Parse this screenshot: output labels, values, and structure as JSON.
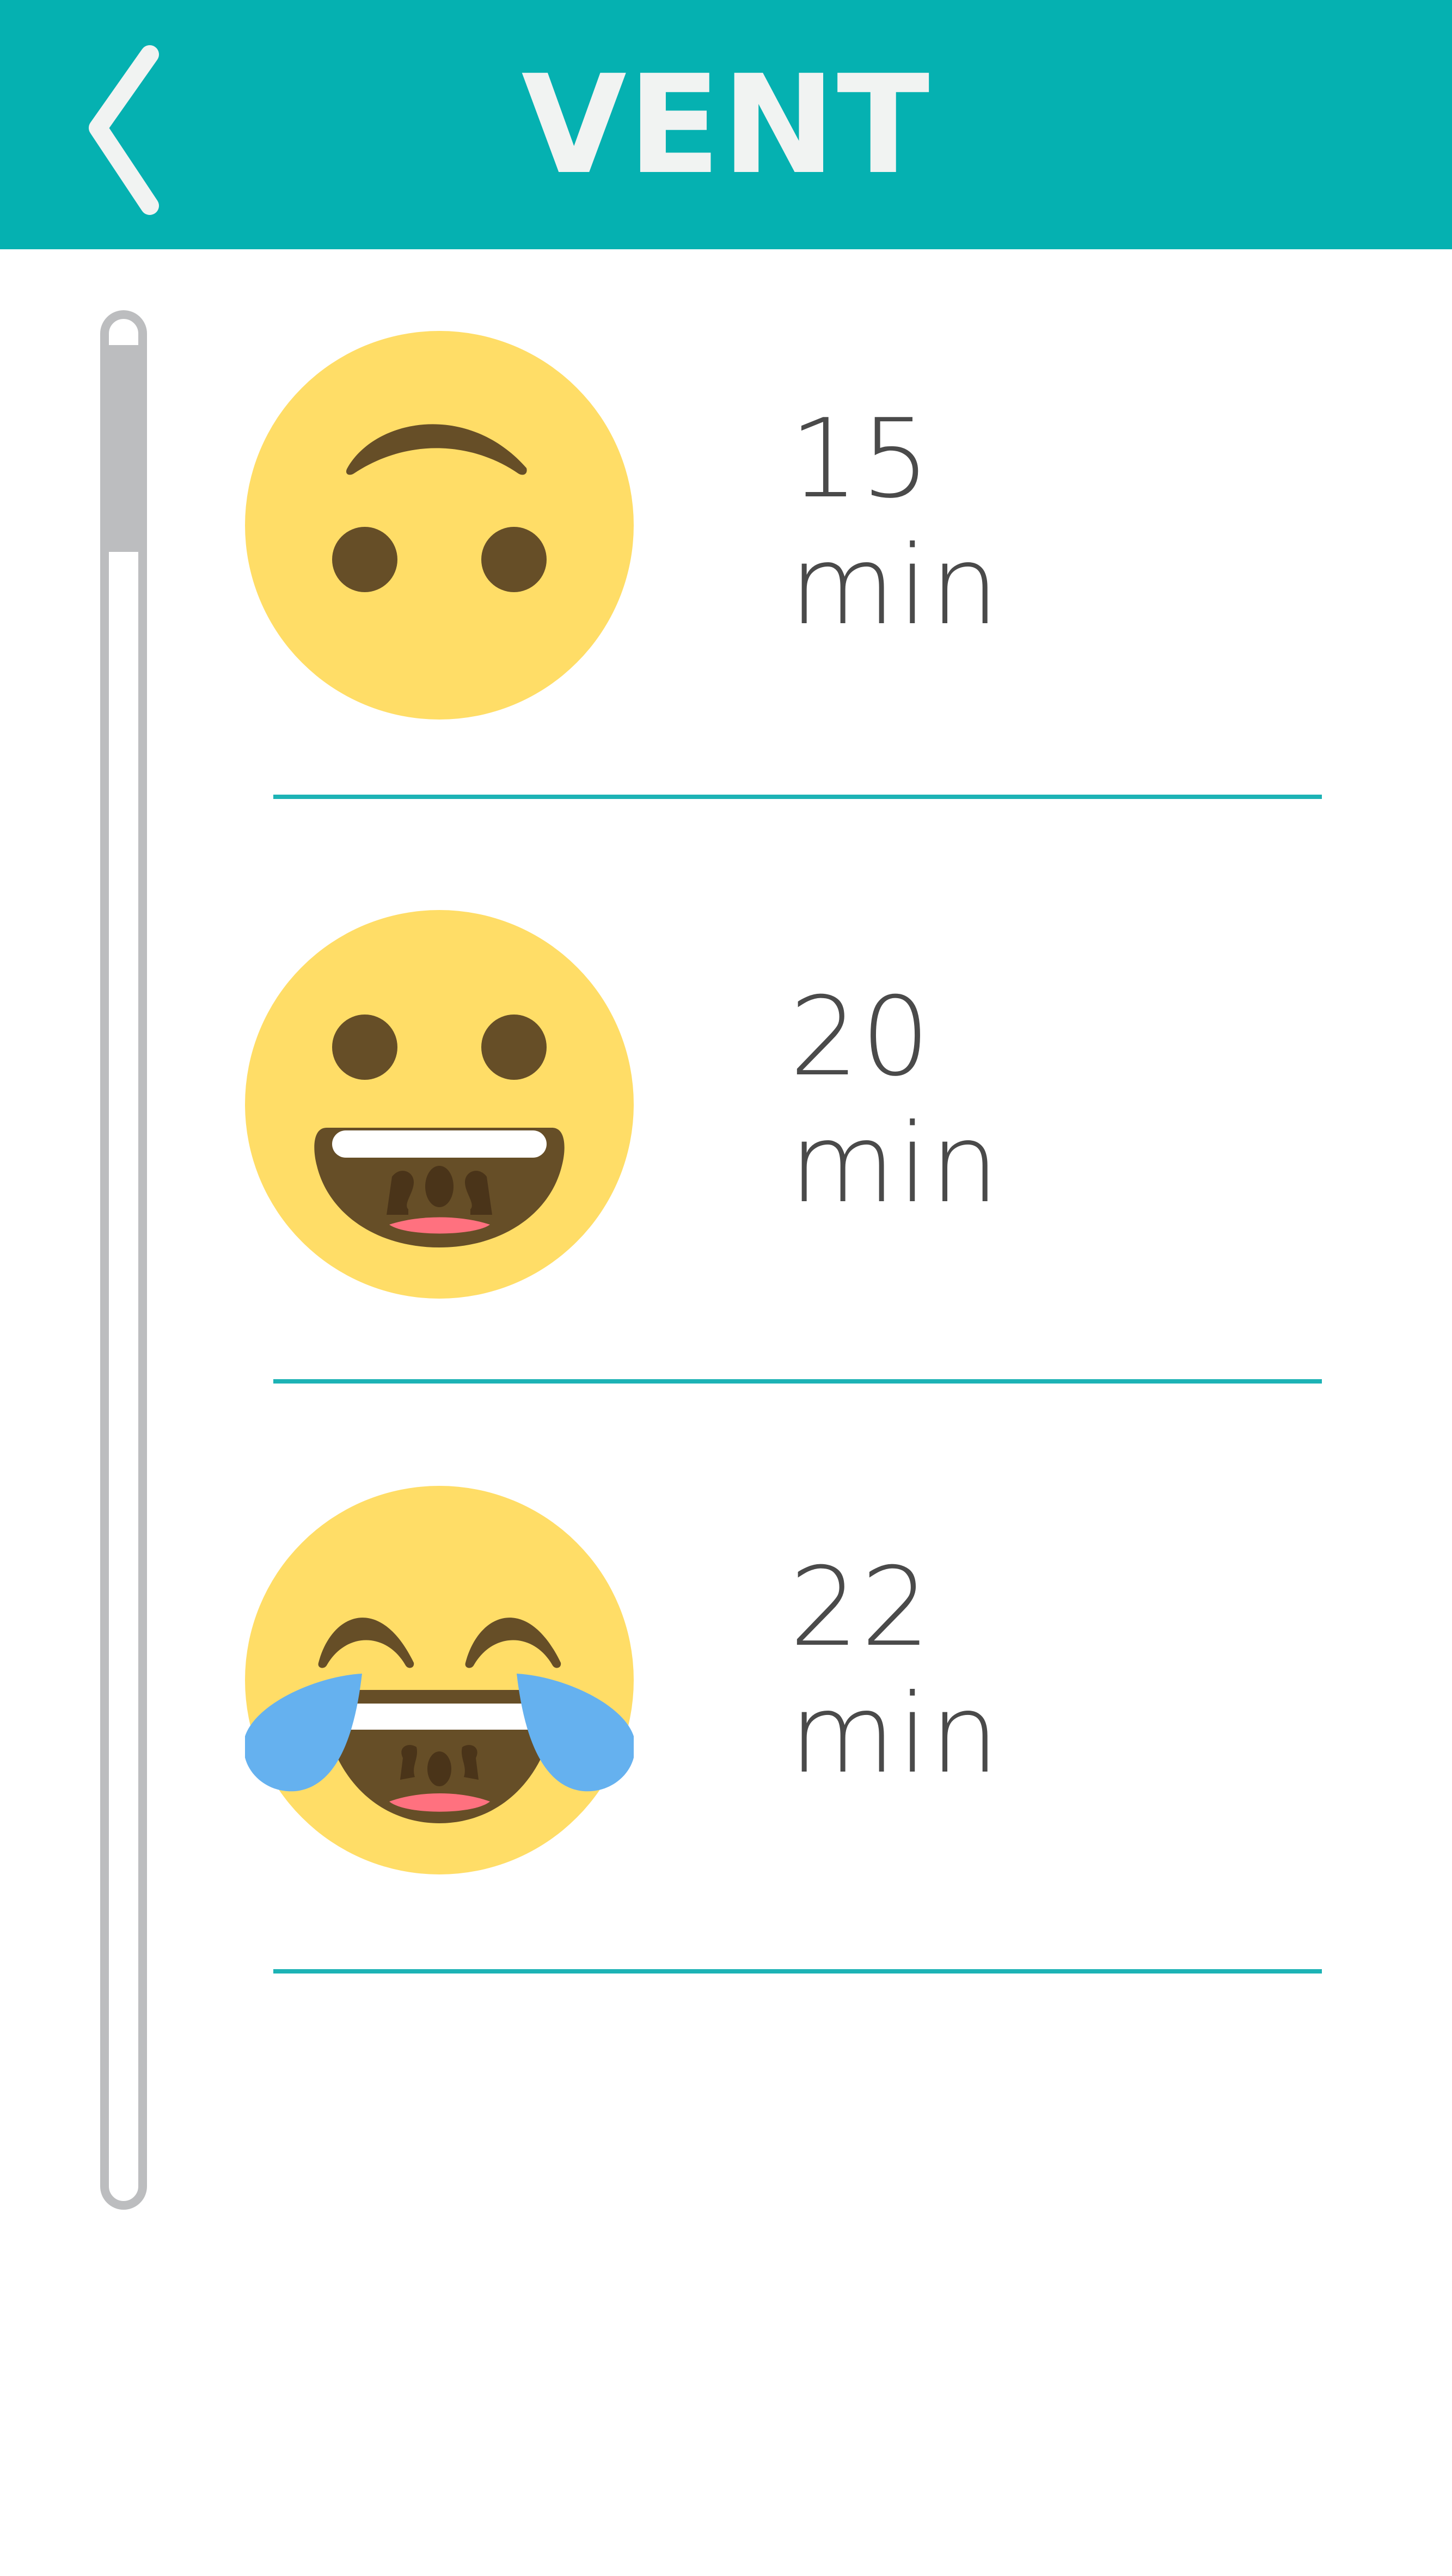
{
  "header": {
    "title": "VENT",
    "back_icon": "chevron-left-icon",
    "background_color": "#05B1B1",
    "title_color": "#F1F3F2"
  },
  "scrollbar": {
    "track_color": "#BCBDBF",
    "position_fraction": 0.0
  },
  "list": {
    "divider_color": "#1DB3B5",
    "items": [
      {
        "emoji": "upside-down-smiling-face-icon",
        "duration": "15 min"
      },
      {
        "emoji": "grinning-face-icon",
        "duration": "20 min"
      },
      {
        "emoji": "face-with-tears-of-joy-icon",
        "duration": "22 min"
      }
    ]
  },
  "colors": {
    "emoji_face": "#FFDD67",
    "emoji_features": "#664E27",
    "tears": "#65B1EF",
    "tongue": "#FF717F"
  }
}
